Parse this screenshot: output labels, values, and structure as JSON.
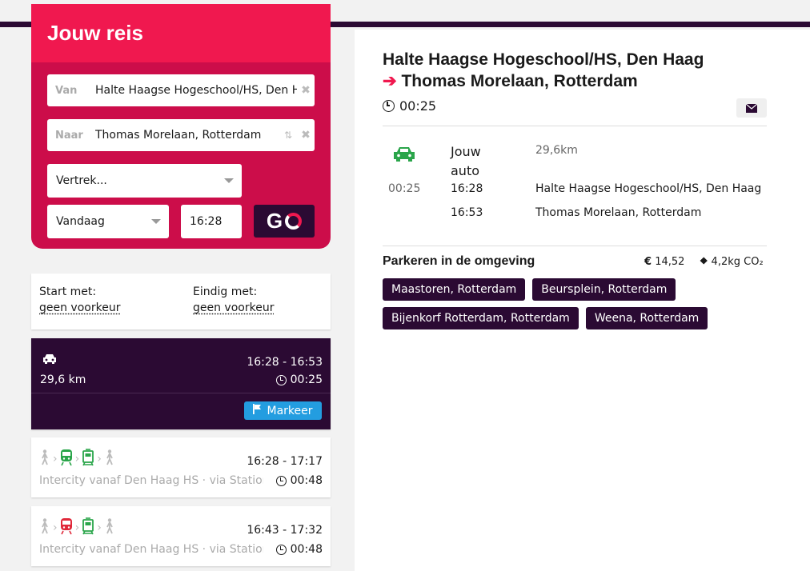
{
  "planner": {
    "title": "Jouw reis",
    "from_label": "Van",
    "from_value": "Halte Haagse Hogeschool/HS, Den H",
    "to_label": "Naar",
    "to_value": "Thomas Morelaan, Rotterdam",
    "mode": "Vertrek...",
    "day": "Vandaag",
    "time": "16:28",
    "go_label": "GO"
  },
  "prefs": {
    "start_title": "Start met:",
    "start_value": "geen voorkeur",
    "end_title": "Eindig met:",
    "end_value": "geen voorkeur"
  },
  "options": [
    {
      "distance": "29,6 km",
      "times": "16:28 - 16:53",
      "duration": "00:25",
      "mark_label": "Markeer"
    },
    {
      "times": "16:28 - 17:17",
      "description": "Intercity vanaf Den Haag HS · via Station ...",
      "duration": "00:48"
    },
    {
      "times": "16:43 - 17:32",
      "description": "Intercity vanaf Den Haag HS · via Station ...",
      "duration": "00:48"
    }
  ],
  "detail": {
    "from": "Halte Haagse Hogeschool/HS, Den Haag",
    "to": "Thomas Morelaan, Rotterdam",
    "duration": "00:25",
    "leg": {
      "mode": "Jouw auto",
      "distance": "29,6km",
      "duration": "00:25",
      "depart_time": "16:28",
      "depart_place": "Halte Haagse Hogeschool/HS, Den Haag",
      "arrive_time": "16:53",
      "arrive_place": "Thomas Morelaan, Rotterdam"
    },
    "parking_title": "Parkeren in de omgeving",
    "cost": "€ 14,52",
    "co2": "4,2kg CO₂",
    "parkings": [
      "Maastoren, Rotterdam",
      "Beursplein, Rotterdam",
      "Bijenkorf Rotterdam, Rotterdam",
      "Weena, Rotterdam"
    ]
  },
  "colors": {
    "brand_dark": "#2b0a33",
    "brand_pink": "#f0184f",
    "car_green": "#2aa54a",
    "train_red": "#e0283a",
    "markeer_blue": "#239de0"
  }
}
